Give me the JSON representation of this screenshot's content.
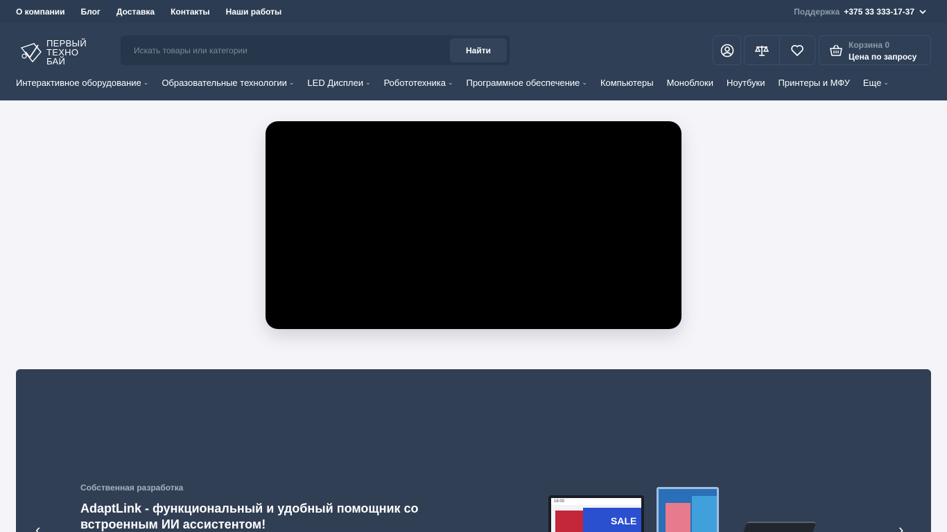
{
  "topbar": {
    "links": [
      "О компании",
      "Блог",
      "Доставка",
      "Контакты",
      "Наши работы"
    ],
    "support_label": "Поддержка",
    "phone": "+375 33 333-17-37"
  },
  "logo": {
    "line1": "ПЕРВЫЙ",
    "line2": "ТЕХНО",
    "line3": "БАЙ"
  },
  "search": {
    "placeholder": "Искать товары или категории",
    "button_label": "Найти"
  },
  "cart": {
    "label": "Корзина 0",
    "price": "Цена по запросу"
  },
  "nav": [
    {
      "label": "Интерактивное оборудование",
      "dropdown": true
    },
    {
      "label": "Образовательные технологии",
      "dropdown": true
    },
    {
      "label": "LED Дисплеи",
      "dropdown": true
    },
    {
      "label": "Робототехника",
      "dropdown": true
    },
    {
      "label": "Программное обеспечение",
      "dropdown": true
    },
    {
      "label": "Компьютеры",
      "dropdown": false
    },
    {
      "label": "Моноблоки",
      "dropdown": false
    },
    {
      "label": "Ноутбуки",
      "dropdown": false
    },
    {
      "label": "Принтеры и МФУ",
      "dropdown": false
    },
    {
      "label": "Еще",
      "dropdown": true
    }
  ],
  "banner": {
    "subtitle": "Собственная разработка",
    "title": "AdaptLink - функциональный и удобный помощник со встроенным ИИ ассистентом!",
    "device_time": "16:00",
    "device_sale": "SALE"
  },
  "colors": {
    "topbar": "#2c3c52",
    "header": "#2e3f56",
    "page_bg": "#f5f5f9",
    "banner": "#313f55"
  }
}
